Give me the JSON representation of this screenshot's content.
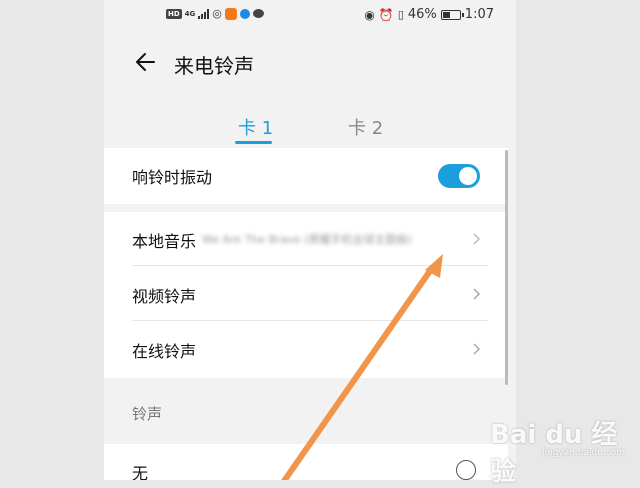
{
  "statusbar": {
    "hd": "HD",
    "network": "4G",
    "battery_text": "46%",
    "battery_level": 0.46,
    "time": "1:07"
  },
  "header": {
    "title": "来电铃声"
  },
  "tabs": [
    {
      "label": "卡 1",
      "active": true
    },
    {
      "label": "卡 2",
      "active": false
    }
  ],
  "settings": {
    "vibrate_label": "响铃时振动",
    "vibrate_on": true,
    "local_music_label": "本地音乐",
    "local_music_value": "We Are The Brave (荣耀手机全球主题曲)",
    "video_label": "视频铃声",
    "online_label": "在线铃声"
  },
  "ringtone_section": {
    "header": "铃声",
    "none_label": "无"
  },
  "watermark": {
    "brand": "Bai du 经验",
    "url": "jingyan.baidu.com"
  },
  "colors": {
    "accent": "#1a9fdc",
    "arrow": "#f0954a"
  }
}
